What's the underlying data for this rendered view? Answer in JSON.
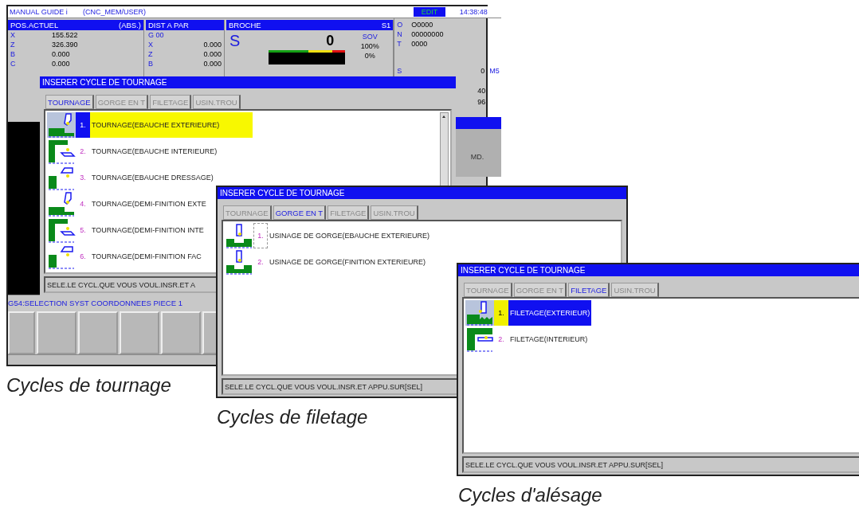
{
  "screens": [
    {
      "kind": "cnc",
      "caption": "Cycles de tournage",
      "header": {
        "title": "MANUAL GUIDE i",
        "path": "(CNC_MEM/USER)",
        "mode": "EDIT",
        "time": "14:38:48"
      },
      "position": {
        "title": "POS.ACTUEL",
        "mode": "(ABS.)",
        "axes": [
          {
            "axis": "X",
            "value": "155.522"
          },
          {
            "axis": "Z",
            "value": "326.390"
          },
          {
            "axis": "B",
            "value": "0.000"
          },
          {
            "axis": "C",
            "value": "0.000"
          }
        ]
      },
      "distance": {
        "title": "DIST A PAR",
        "gcode": "G 00",
        "axes": [
          {
            "axis": "X",
            "value": "0.000"
          },
          {
            "axis": "Z",
            "value": "0.000"
          },
          {
            "axis": "B",
            "value": "0.000"
          }
        ]
      },
      "spindle": {
        "title": "BROCHE",
        "channel": "S1",
        "symbol": "S",
        "speed": "0",
        "override_label": "SOV",
        "override": "100%",
        "load": "0%"
      },
      "program": {
        "rows": [
          {
            "label": "O",
            "value": "O0000"
          },
          {
            "label": "N",
            "value": "00000000"
          },
          {
            "label": "T",
            "value": "0000"
          }
        ],
        "spindle_label": "S",
        "spindle_value": "0",
        "mcode": "M5",
        "values": [
          "40",
          "96"
        ],
        "note": "MD."
      },
      "message": "G54:SELECTION SYST COORDONNEES PIECE 1",
      "dialog": {
        "title": "INSERER CYCLE DE TOURNAGE",
        "scrollbar": true,
        "cursor_on_label": true,
        "tabs": [
          {
            "label": "TOURNAGE",
            "selected": true
          },
          {
            "label": "GORGE EN T",
            "selected": false
          },
          {
            "label": "FILETAGE",
            "selected": false
          },
          {
            "label": "USIN.TROU",
            "selected": false
          }
        ],
        "items": [
          {
            "number": "1.",
            "label": "TOURNAGE(EBAUCHE EXTERIEURE)",
            "kind": "outer",
            "selected": true,
            "focused": true
          },
          {
            "number": "2.",
            "label": "TOURNAGE(EBAUCHE INTERIEURE)",
            "kind": "inner",
            "selected": false,
            "focused": false
          },
          {
            "number": "3.",
            "label": "TOURNAGE(EBAUCHE DRESSAGE)",
            "kind": "facing",
            "selected": false,
            "focused": false
          },
          {
            "number": "4.",
            "label": "TOURNAGE(DEMI-FINITION EXTE",
            "kind": "outer",
            "selected": false,
            "focused": false
          },
          {
            "number": "5.",
            "label": "TOURNAGE(DEMI-FINITION INTE",
            "kind": "inner",
            "selected": false,
            "focused": false
          },
          {
            "number": "6.",
            "label": "TOURNAGE(DEMI-FINITION FAC",
            "kind": "facing",
            "selected": false,
            "focused": false
          }
        ],
        "status": "SELE.LE CYCL.QUE VOUS VOUL.INSR.ET A"
      }
    },
    {
      "kind": "dialog",
      "caption": "Cycles de filetage",
      "dialog": {
        "title": "INSERER CYCLE DE TOURNAGE",
        "scrollbar": false,
        "cursor_on_label": false,
        "tabs": [
          {
            "label": "TOURNAGE",
            "selected": false
          },
          {
            "label": "GORGE EN T",
            "selected": true
          },
          {
            "label": "FILETAGE",
            "selected": false
          },
          {
            "label": "USIN.TROU",
            "selected": false
          }
        ],
        "items": [
          {
            "number": "1.",
            "label": "USINAGE DE GORGE(EBAUCHE EXTERIEURE)",
            "kind": "groove",
            "selected": false,
            "focused": true
          },
          {
            "number": "2.",
            "label": "USINAGE DE GORGE(FINITION EXTERIEURE)",
            "kind": "groove",
            "selected": false,
            "focused": false
          }
        ],
        "status": "SELE.LE CYCL.QUE VOUS VOUL.INSR.ET APPU.SUR[SEL]"
      }
    },
    {
      "kind": "dialog",
      "caption": "Cycles d'alésage",
      "dialog": {
        "title": "INSERER CYCLE DE TOURNAGE",
        "scrollbar": false,
        "cursor_on_label": false,
        "tabs": [
          {
            "label": "TOURNAGE",
            "selected": false
          },
          {
            "label": "GORGE EN T",
            "selected": false
          },
          {
            "label": "FILETAGE",
            "selected": true
          },
          {
            "label": "USIN.TROU",
            "selected": false
          }
        ],
        "items": [
          {
            "number": "1.",
            "label": "FILETAGE(EXTERIEUR)",
            "kind": "thread_outer",
            "selected": true,
            "focused": true
          },
          {
            "number": "2.",
            "label": "FILETAGE(INTERIEUR)",
            "kind": "thread_inner",
            "selected": false,
            "focused": false
          }
        ],
        "status": "SELE.LE CYCL.QUE VOUS VOUL.INSR.ET APPU.SUR[SEL]"
      }
    }
  ]
}
